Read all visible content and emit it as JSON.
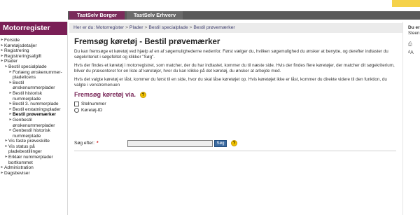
{
  "tabs": [
    {
      "label": "TastSelv Borger",
      "active": true
    },
    {
      "label": "TastSelv Erhverv",
      "active": false
    }
  ],
  "sidebar": {
    "title": "Motorregister",
    "items": [
      {
        "label": "Forside",
        "level": 0
      },
      {
        "label": "Køretøjsdetaljer",
        "level": 0
      },
      {
        "label": "Registrering",
        "level": 0
      },
      {
        "label": "Registreringsafgift",
        "level": 0
      },
      {
        "label": "Plader",
        "level": 0
      },
      {
        "label": "Bestil specialplade",
        "level": 1
      },
      {
        "label": "Forlæng ønskenummer-pladelicens",
        "level": 2
      },
      {
        "label": "Bestil ønskenummerplader",
        "level": 2
      },
      {
        "label": "Bestil historisk nummerplade",
        "level": 2
      },
      {
        "label": "Bestil 3. nummerplade",
        "level": 2
      },
      {
        "label": "Bestil erstatningsplader",
        "level": 2
      },
      {
        "label": "Bestil prøvemærker",
        "level": 2,
        "active": true
      },
      {
        "label": "Genbestil ønskenummerplader",
        "level": 2
      },
      {
        "label": "Genbestil historisk nummerplade",
        "level": 2
      },
      {
        "label": "Vis faste prøveskilte",
        "level": 1
      },
      {
        "label": "Vis status på pladebestillinger",
        "level": 1
      },
      {
        "label": "Erklær nummerplader bortkommet",
        "level": 1
      },
      {
        "label": "Administration",
        "level": 0
      },
      {
        "label": "Dagsbeviser",
        "level": 0
      }
    ]
  },
  "breadcrumb": {
    "prefix": "Her er du:",
    "items": [
      "Motorregister",
      "Plader",
      "Bestil specialplade",
      "Bestil prøvemærker"
    ]
  },
  "main": {
    "title": "Fremsøg køretøj - Bestil prøvemærker",
    "paragraphs": [
      "Du kan fremsøge et køretøj ved hjælp af en af søgemulighederne nedenfor. Først vælger du, hvilken søgemulighed du ønsker at benytte, og derefter indtaster du søgekriteriet i søgefeltet og klikker \"Søg\".",
      "Hvis der findes et køretøj i motorregistret, som matcher, der du har indtastet, kommer du til næste side. Hvis der findes flere køretøjer, der matcher dit søgekriterium, bliver du præsenteret for en liste af køretøjer, hvor du kan klikke på det køretøj, du ønsker at arbejde med.",
      "Hvis det valgte køretøj er låst, kommer du først til en side, hvor du skal låse køretøjet op. Hvis køretøjet ikke er låst, kommer du direkte videre til den funktion, du valgte i venstremenuen"
    ],
    "search_section_title": "Fremsøg køretøj via.",
    "options": [
      {
        "label": "Stelnummer",
        "type": "checkbox"
      },
      {
        "label": "Køretøj-ID",
        "type": "radio"
      }
    ],
    "search_label": "Søg efter:",
    "search_value": "",
    "search_button": "Søg"
  },
  "right_panel": {
    "header": "Du er",
    "sub": "Steen"
  },
  "colors": {
    "brand": "#7a1f56",
    "tab_active": "#7a2a5a",
    "tab_bar": "#5a5a5a",
    "search_button": "#3b6aa0",
    "help_icon": "#f2c300"
  }
}
